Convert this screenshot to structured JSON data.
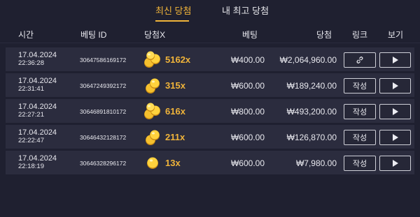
{
  "tabs": [
    {
      "label": "최신 당첨",
      "active": true
    },
    {
      "label": "내 최고 당첨",
      "active": false
    }
  ],
  "columns": {
    "time": "시간",
    "bet_id": "베팅 ID",
    "multiplier": "당첨X",
    "bet": "베팅",
    "win": "당첨",
    "link": "링크",
    "view": "보기"
  },
  "rows": [
    {
      "date": "17.04.2024",
      "time": "22:36:28",
      "bet_id": "30647586169172",
      "multiplier": "5162x",
      "bet": "₩400.00",
      "win": "₩2,064,960.00",
      "link_type": "link-icon",
      "link_label": ""
    },
    {
      "date": "17.04.2024",
      "time": "22:31:41",
      "bet_id": "30647249392172",
      "multiplier": "315x",
      "bet": "₩600.00",
      "win": "₩189,240.00",
      "link_type": "text",
      "link_label": "작성"
    },
    {
      "date": "17.04.2024",
      "time": "22:27:21",
      "bet_id": "30646891810172",
      "multiplier": "616x",
      "bet": "₩800.00",
      "win": "₩493,200.00",
      "link_type": "text",
      "link_label": "작성"
    },
    {
      "date": "17.04.2024",
      "time": "22:22:47",
      "bet_id": "30646432128172",
      "multiplier": "211x",
      "bet": "₩600.00",
      "win": "₩126,870.00",
      "link_type": "text",
      "link_label": "작성"
    },
    {
      "date": "17.04.2024",
      "time": "22:18:19",
      "bet_id": "30646328296172",
      "multiplier": "13x",
      "bet": "₩600.00",
      "win": "₩7,980.00",
      "link_type": "text",
      "link_label": "작성"
    }
  ],
  "colors": {
    "background": "#1f2030",
    "row_background": "#2b2c3e",
    "accent": "#f0b43a",
    "text": "#e8e8ee"
  }
}
